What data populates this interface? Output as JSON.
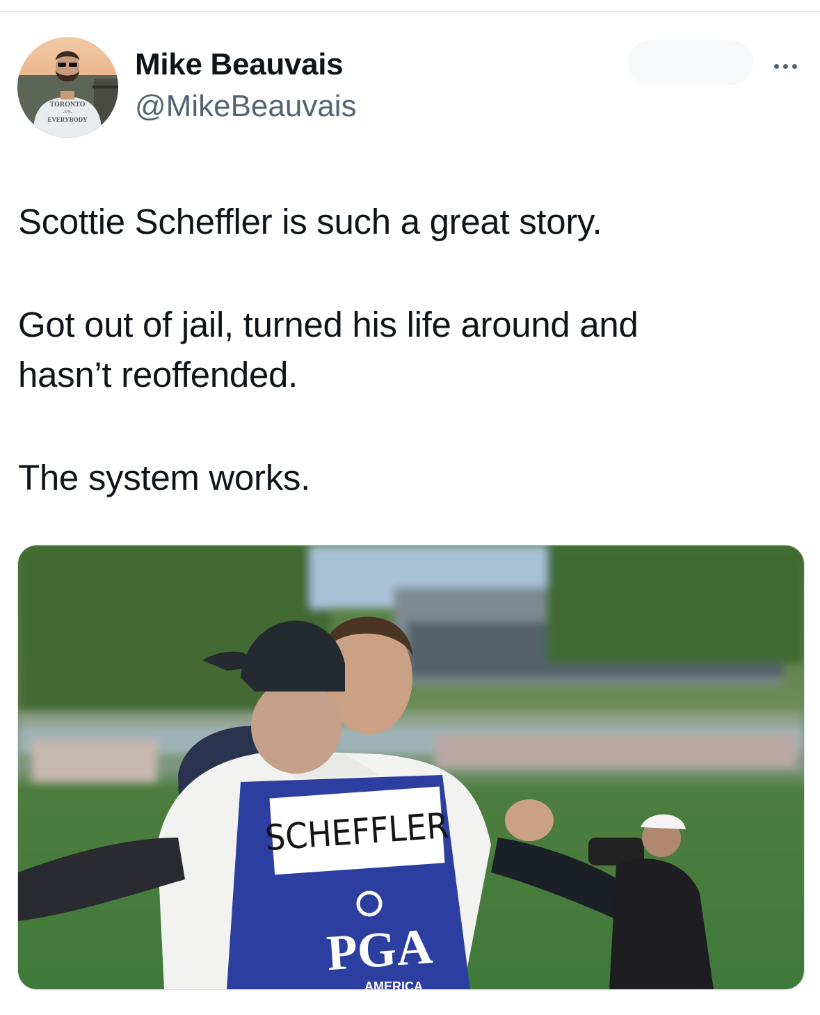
{
  "author": {
    "name": "Mike Beauvais",
    "handle": "@MikeBeauvais",
    "avatar_shirt_text": [
      "TORONTO",
      "-VS-",
      "EVERYBODY"
    ]
  },
  "follow_button_label": "",
  "more_icon": "more-horizontal-icon",
  "tweet": {
    "line1": "Scottie Scheffler is such a great story.",
    "line2": "Got out of jail, turned his life around and",
    "line3": "hasn’t reoffended.",
    "line4": "The system works."
  },
  "media": {
    "bib_name": "SCHEFFLER",
    "bib_logo": "PGA",
    "bib_sub": "AMERICA"
  },
  "colors": {
    "text": "#0f1419",
    "secondary": "#536471",
    "bib_blue": "#2c3fa0",
    "grass": "#3f7a3a"
  }
}
